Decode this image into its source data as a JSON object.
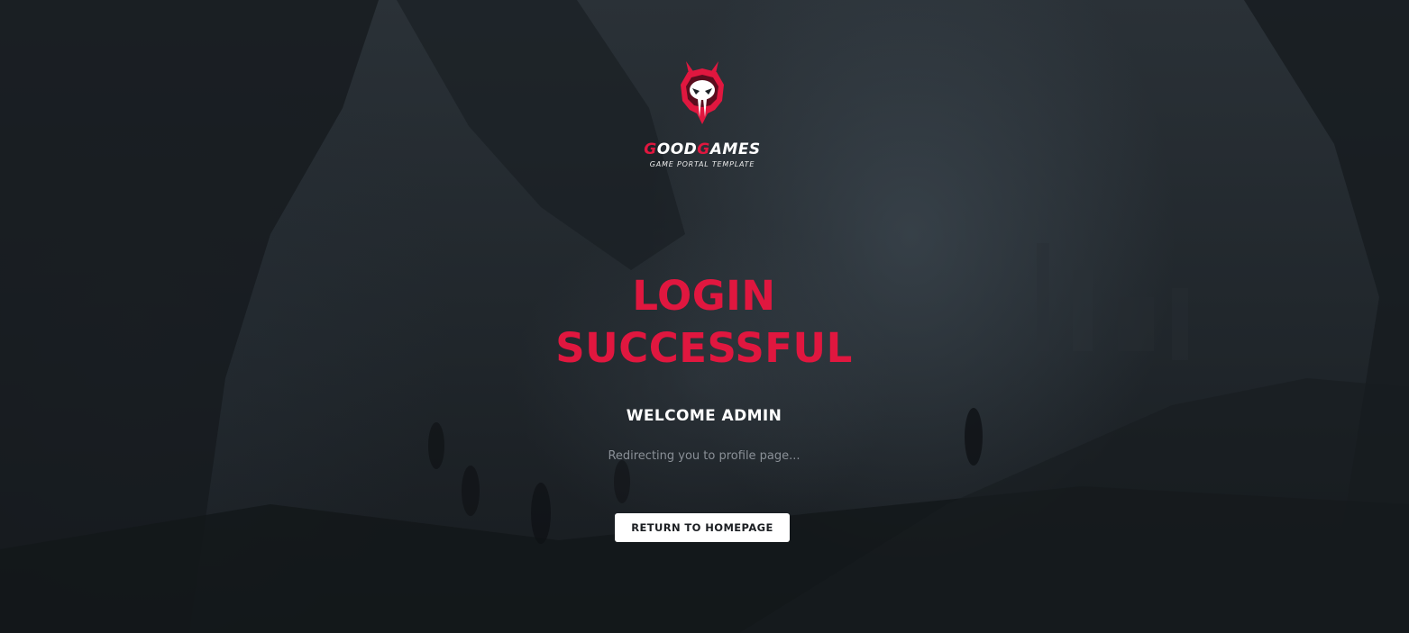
{
  "logo": {
    "brand_part1": "G",
    "brand_part2": "OOD",
    "brand_part3": "G",
    "brand_part4": "AMES",
    "tagline": "GAME PORTAL TEMPLATE",
    "icon": "demon-skull-icon"
  },
  "main": {
    "heading_line1": "LOGIN",
    "heading_line2": "SUCCESSFUL",
    "welcome": "WELCOME ADMIN",
    "redirect_text": "Redirecting you to profile page...",
    "return_button": "RETURN TO HOMEPAGE"
  },
  "colors": {
    "accent": "#e0173f",
    "background": "#1b2025",
    "text": "#ffffff",
    "muted": "#8a9097"
  }
}
